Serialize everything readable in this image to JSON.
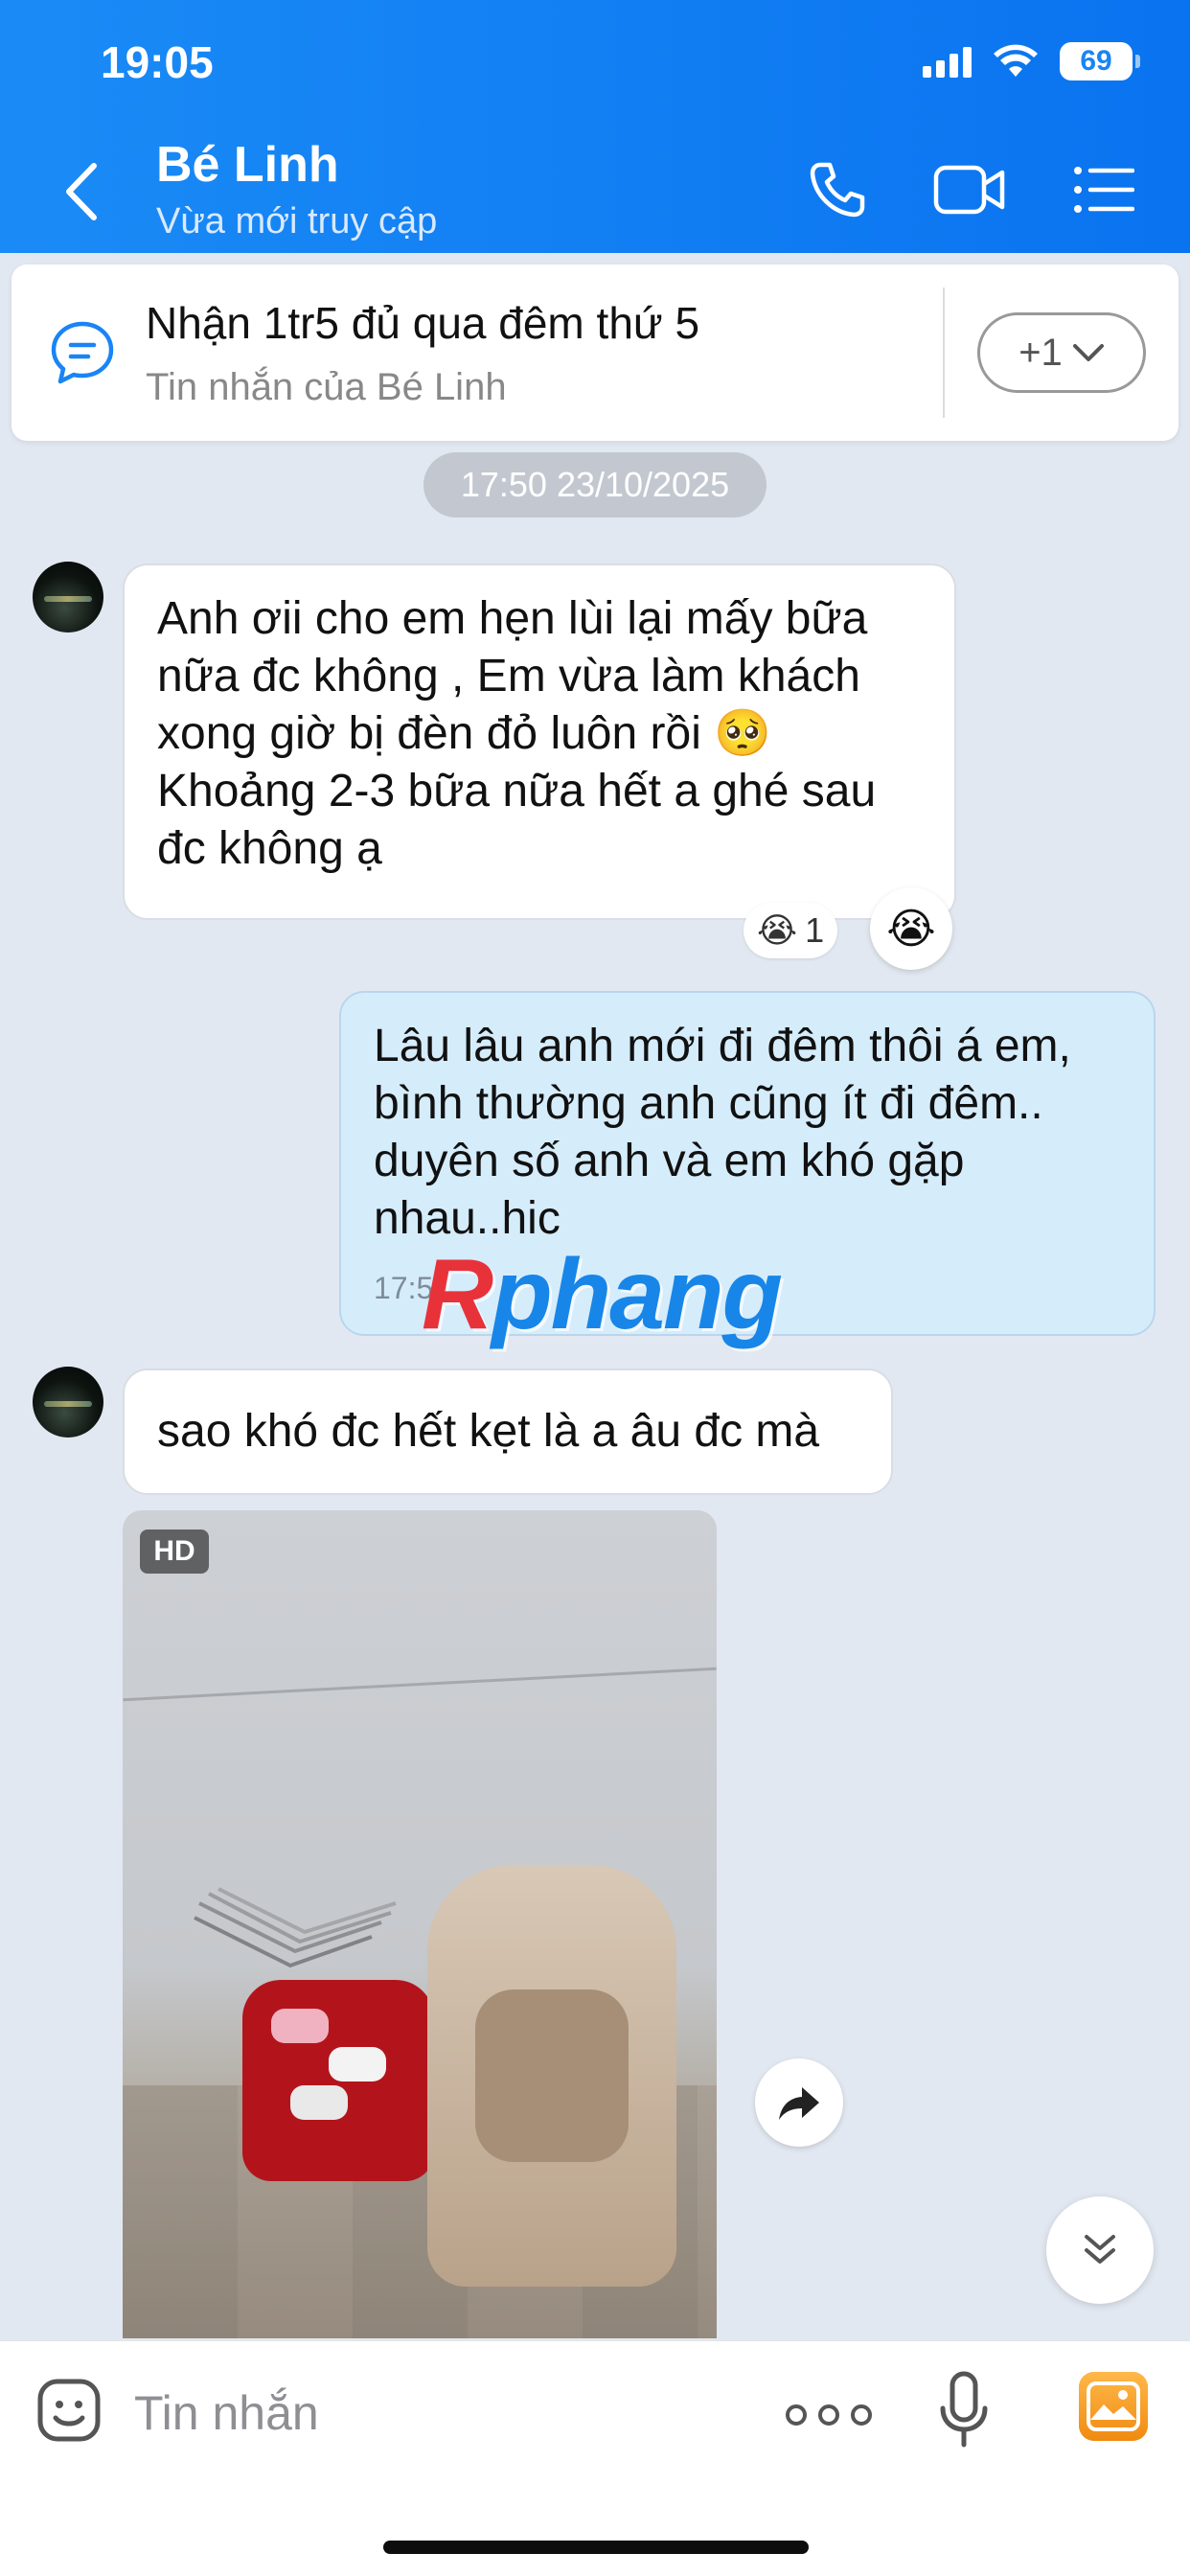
{
  "status_bar": {
    "time": "19:05",
    "battery": "69"
  },
  "header": {
    "contact_name": "Bé Linh",
    "contact_status": "Vừa mới truy cập"
  },
  "pinned": {
    "title": "Nhận 1tr5 đủ qua đêm thứ 5",
    "subtitle": "Tin nhắn của Bé Linh",
    "more_label": "+1"
  },
  "date_separator": "17:50 23/10/2025",
  "messages": [
    {
      "from": "Bé Linh",
      "text": "Anh ơii cho em hẹn lùi lại mấy bữa nữa đc không , Em vừa làm khách xong giờ bị đèn đỏ luôn rồi 🥺 Khoảng 2-3 bữa nữa hết a ghé sau đc không ạ",
      "reaction": "😭",
      "reaction_count": "1"
    },
    {
      "from": "me",
      "text": "Lâu lâu anh mới đi đêm thôi á em, bình thường anh cũng ít đi đêm.. duyên số anh và em khó gặp nhau..hic",
      "time": "17:54"
    },
    {
      "from": "Bé Linh",
      "text": "sao khó đc hết kẹt là a âu đc mà"
    },
    {
      "from": "Bé Linh",
      "type": "image",
      "badge": "HD"
    }
  ],
  "watermark": {
    "first": "R",
    "rest": "phang"
  },
  "input": {
    "placeholder": "Tin nhắn"
  },
  "colors": {
    "header": "#0a73f0",
    "outgoing_bubble": "#d5ecfb",
    "background": "#e2e8f1"
  }
}
